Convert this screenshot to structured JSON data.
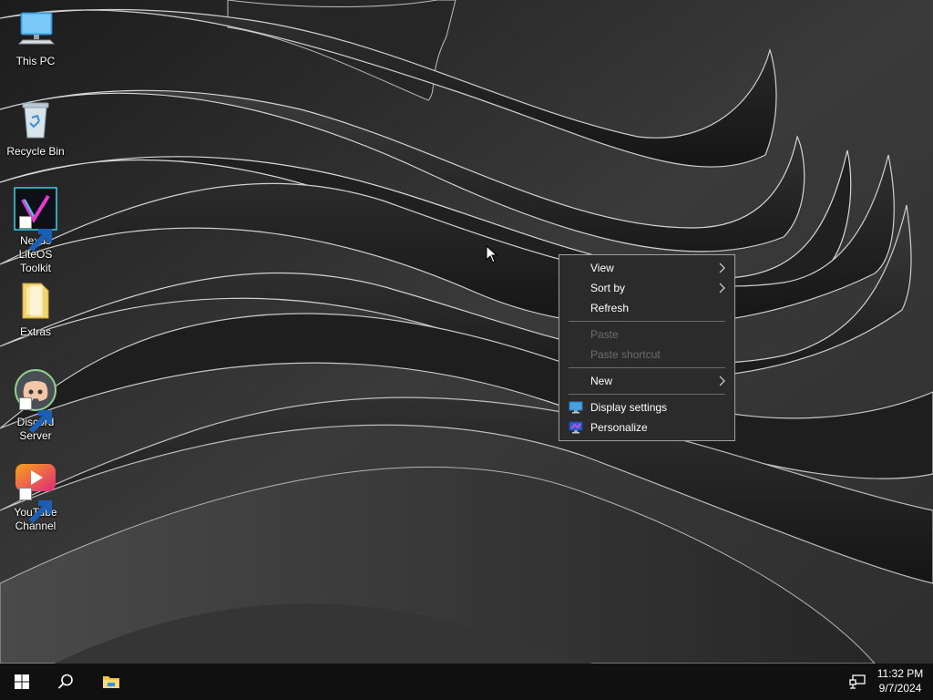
{
  "desktop": {
    "icons": [
      {
        "label": "This PC",
        "icon": "computer-icon"
      },
      {
        "label": "Recycle Bin",
        "icon": "recycle-bin-icon"
      },
      {
        "label": "Nexus LiteOS Toolkit",
        "icon": "nexus-liteos-logo-icon",
        "shortcut": true
      },
      {
        "label": "Extras",
        "icon": "folder-icon"
      },
      {
        "label": "Discord Server",
        "icon": "discord-icon",
        "shortcut": true
      },
      {
        "label": "YouTube Channel",
        "icon": "youtube-icon",
        "shortcut": true
      }
    ]
  },
  "context_menu": {
    "view": "View",
    "sort_by": "Sort by",
    "refresh": "Refresh",
    "paste": "Paste",
    "paste_shortcut": "Paste shortcut",
    "new": "New",
    "display_settings": "Display settings",
    "personalize": "Personalize"
  },
  "taskbar": {
    "start_icon": "windows-logo-icon",
    "search_icon": "search-icon",
    "explorer_icon": "file-explorer-icon",
    "network_icon": "network-icon",
    "time": "11:32 PM",
    "date": "9/7/2024"
  },
  "colors": {
    "taskbar": "#101010",
    "menu_background": "#2b2b2b",
    "menu_border": "#a0a0a0",
    "disabled_text": "#6d6d6d"
  }
}
